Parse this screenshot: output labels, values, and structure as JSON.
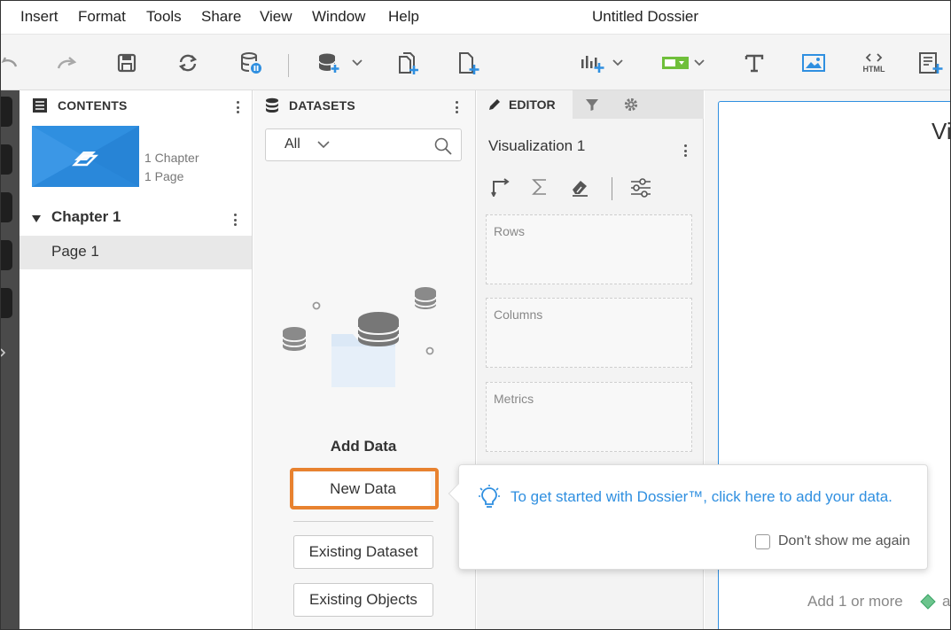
{
  "menu": {
    "items": [
      "Insert",
      "Format",
      "Tools",
      "Share",
      "View",
      "Window",
      "Help"
    ],
    "title": "Untitled Dossier"
  },
  "toolbar": {
    "html_label": "HTML",
    "buttons": [
      "undo-icon",
      "redo-icon",
      "save-icon",
      "refresh-icon",
      "data-pause-icon",
      "add-dataset-dropdown",
      "duplicate-page-icon",
      "new-page-icon",
      "insert-visualization-dropdown",
      "insert-filter-dropdown",
      "text-icon",
      "image-icon",
      "html-container-icon",
      "insert-panel-icon"
    ]
  },
  "contents": {
    "header": "CONTENTS",
    "chapter_count": "1 Chapter",
    "page_count": "1 Page",
    "chapter": "Chapter 1",
    "page": "Page 1"
  },
  "datasets": {
    "header": "DATASETS",
    "filter_value": "All",
    "add_data_title": "Add Data",
    "new_data": "New Data",
    "existing_dataset": "Existing Dataset",
    "existing_objects": "Existing Objects"
  },
  "editor": {
    "tab_label": "EDITOR",
    "viz_title": "Visualization 1",
    "zones": {
      "rows": "Rows",
      "columns": "Columns",
      "metrics": "Metrics"
    }
  },
  "canvas": {
    "title_fragment": "Vi",
    "hint": "Add 1 or more",
    "hint_tail": "a"
  },
  "tooltip": {
    "message": "To get started with Dossier™, click here to add your data.",
    "checkbox_label": "Don't show me again"
  },
  "colors": {
    "accent": "#2f8fe0",
    "highlight": "#e8822f",
    "green": "#6fbf3a"
  }
}
